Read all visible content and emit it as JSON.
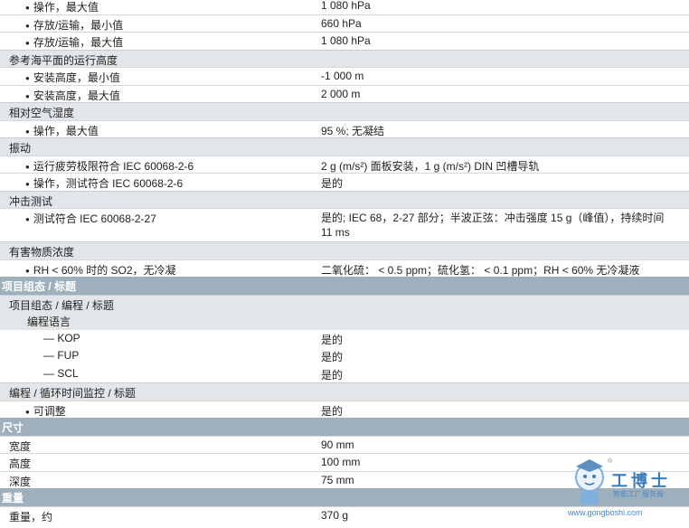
{
  "rows": [
    {
      "type": "item",
      "label": "操作，最大值",
      "value": "1 080 hPa"
    },
    {
      "type": "item",
      "label": "存放/运输，最小值",
      "value": "660 hPa"
    },
    {
      "type": "item",
      "label": "存放/运输，最大值",
      "value": "1 080 hPa"
    },
    {
      "type": "sub",
      "label": "参考海平面的运行高度",
      "value": ""
    },
    {
      "type": "item",
      "label": "安装高度，最小值",
      "value": "-1 000 m"
    },
    {
      "type": "item",
      "label": "安装高度，最大值",
      "value": "2 000 m"
    },
    {
      "type": "sub",
      "label": "相对空气湿度",
      "value": ""
    },
    {
      "type": "item",
      "label": "操作，最大值",
      "value": "95 %; 无凝结"
    },
    {
      "type": "sub",
      "label": "振动",
      "value": ""
    },
    {
      "type": "item",
      "label": "运行疲劳极限符合 IEC 60068-2-6",
      "value": "2 g (m/s²) 面板安装，1 g (m/s²) DIN 凹槽导轨"
    },
    {
      "type": "item",
      "label": "操作，测试符合 IEC 60068-2-6",
      "value": "是的"
    },
    {
      "type": "sub",
      "label": "冲击测试",
      "value": ""
    },
    {
      "type": "item",
      "label": "测试符合 IEC 60068-2-27",
      "value": "是的; IEC 68，2-27 部分；半波正弦：冲击强度 15 g（峰值），持续时间 11 ms",
      "tall": true
    },
    {
      "type": "sub",
      "label": "有害物质浓度",
      "value": ""
    },
    {
      "type": "item",
      "label": "RH < 60% 时的 SO2，无冷凝",
      "value": "二氧化硫： < 0.5 ppm；硫化氢： < 0.1 ppm；RH < 60% 无冷凝液"
    },
    {
      "type": "main",
      "label": "项目组态 / 标题",
      "value": ""
    },
    {
      "type": "sub",
      "label": "项目组态 / 编程 / 标题",
      "value": ""
    },
    {
      "type": "sub2",
      "label": "编程语言",
      "value": ""
    },
    {
      "type": "dash",
      "label": "— KOP",
      "value": "是的"
    },
    {
      "type": "dash",
      "label": "— FUP",
      "value": "是的"
    },
    {
      "type": "dash",
      "label": "— SCL",
      "value": "是的"
    },
    {
      "type": "sub",
      "label": "编程 / 循环时间监控 / 标题",
      "value": ""
    },
    {
      "type": "item",
      "label": "可调整",
      "value": "是的"
    },
    {
      "type": "main",
      "label": "尺寸",
      "value": ""
    },
    {
      "type": "plain",
      "label": "宽度",
      "value": "90 mm"
    },
    {
      "type": "plain",
      "label": "高度",
      "value": "100 mm"
    },
    {
      "type": "plain",
      "label": "深度",
      "value": "75 mm"
    },
    {
      "type": "main",
      "label": "重量",
      "value": ""
    },
    {
      "type": "plain",
      "label": "重量，约",
      "value": "370 g"
    }
  ],
  "watermark": {
    "title": "工博士",
    "subtitle": "智能工厂服务商",
    "url": "www.gongboshi.com",
    "registered": "®"
  }
}
